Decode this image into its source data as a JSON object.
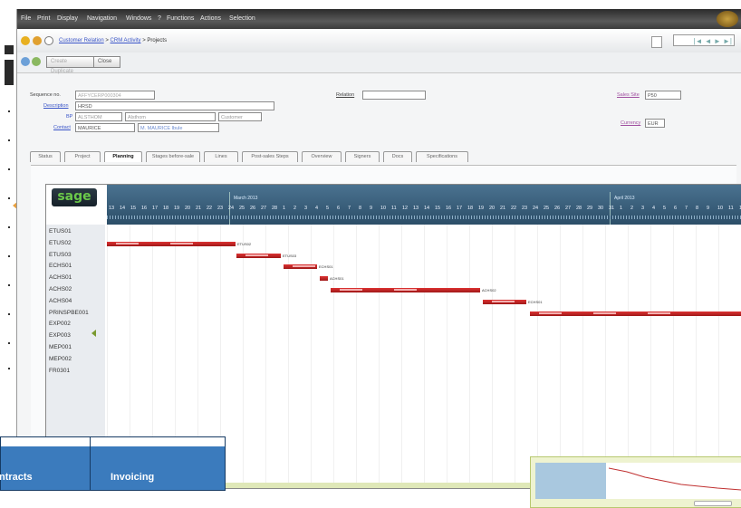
{
  "menubar": {
    "items": [
      "File",
      "Print",
      "Display",
      "Navigation",
      "Windows",
      "?",
      "Functions",
      "Actions",
      "Selection"
    ]
  },
  "pathbar": {
    "crumbs": [
      "Customer Relation",
      "CRM Activity",
      "Projects"
    ],
    "nav_value": "|◄ ◄ ► ►|"
  },
  "toolbar": {
    "create_label": "Create Duplicate",
    "close_label": "Close"
  },
  "form": {
    "sequence_label": "Sequence no.",
    "sequence_value": "AFFYCERP000304",
    "description_label": "Description",
    "description_value": "HRSD",
    "bp_label": "BP",
    "bp_value": "ALSTHOM",
    "bp_name": "Alsthom",
    "bp_type": "Customer",
    "contact_label": "Contact",
    "contact_value": "MAURICE",
    "contact_name": "M. MAURICE Ibule",
    "relation_label": "Relation",
    "sales_site_label": "Sales Site",
    "sales_site_value": "P50",
    "currency_label": "Currency",
    "currency_value": "EUR"
  },
  "tabs": [
    {
      "label": "Status"
    },
    {
      "label": "Project"
    },
    {
      "label": "Planning"
    },
    {
      "label": "Stages before-sale"
    },
    {
      "label": "Lines"
    },
    {
      "label": "Post-sales Steps"
    },
    {
      "label": "Overview"
    },
    {
      "label": "Signers"
    },
    {
      "label": "Docs"
    },
    {
      "label": "Specifications"
    }
  ],
  "gantt": {
    "logo": "sage",
    "months": [
      "March 2013",
      "April 2013"
    ],
    "days": [
      "13",
      "14",
      "15",
      "16",
      "17",
      "18",
      "19",
      "20",
      "21",
      "22",
      "23",
      "24",
      "25",
      "26",
      "27",
      "28",
      "1",
      "2",
      "3",
      "4",
      "5",
      "6",
      "7",
      "8",
      "9",
      "10",
      "11",
      "12",
      "13",
      "14",
      "15",
      "16",
      "17",
      "18",
      "19",
      "20",
      "21",
      "22",
      "23",
      "24",
      "25",
      "26",
      "27",
      "28",
      "29",
      "30",
      "31",
      "1",
      "2",
      "3",
      "4",
      "5",
      "6",
      "7",
      "8",
      "9",
      "10",
      "11",
      "12"
    ],
    "rows": [
      "ETUS01",
      "ETUS02",
      "ETUS03",
      "ECHS01",
      "ACHS01",
      "ACHS02",
      "ACHS04",
      "PRINSPBE001",
      "EXP002",
      "EXP003",
      "MEP001",
      "MEP002",
      "FR0301"
    ],
    "bars": [
      {
        "row": "ETUS02",
        "label": "ETUS02",
        "start": 0,
        "end": 142
      },
      {
        "row": "ETUS03",
        "label": "ETUS03",
        "start": 143,
        "end": 192
      },
      {
        "row": "ECHS01",
        "label": "ECHS01",
        "start": 195,
        "end": 232
      },
      {
        "row": "ACHS01",
        "label": "ACHS01",
        "start": 235,
        "end": 244
      },
      {
        "row": "ACHS02",
        "label": "ACHS02",
        "start": 247,
        "end": 412
      },
      {
        "row": "ACHS04",
        "label": "ECHS01",
        "start": 415,
        "end": 463
      },
      {
        "row": "PRINSPBE001",
        "label": "",
        "start": 467,
        "end": 700
      }
    ]
  },
  "bottom_nav": {
    "contracts_label": "ntracts",
    "invoicing_label": "Invoicing"
  },
  "colors": {
    "menubar": "#3c3c3c",
    "timeline": "#3a5f7c",
    "bar": "#c02020",
    "nav_blue": "#3b7bbd",
    "sage_green": "#6bc84a"
  }
}
